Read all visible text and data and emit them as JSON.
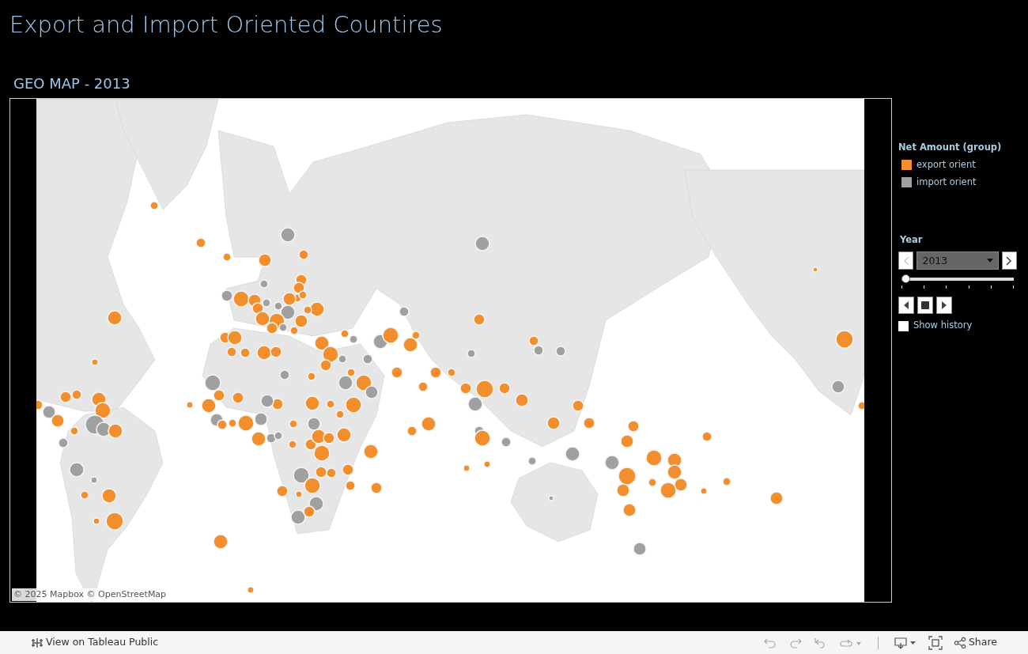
{
  "dashboard": {
    "title": "Export and Import Oriented Countires"
  },
  "map": {
    "title": "GEO MAP - 2013",
    "attribution": "© 2025 Mapbox © OpenStreetMap"
  },
  "legend": {
    "title": "Net Amount (group)",
    "items": [
      {
        "label": "export orient",
        "color": "#f28e2b"
      },
      {
        "label": "import orient",
        "color": "#a0a0a0"
      }
    ]
  },
  "year_filter": {
    "title": "Year",
    "value": "2013",
    "prev_disabled": true,
    "next_disabled": false,
    "level": 0,
    "show_history": {
      "label": "Show history",
      "checked": false
    }
  },
  "toolbar": {
    "view_link": "View on Tableau Public",
    "share": "Share"
  }
}
